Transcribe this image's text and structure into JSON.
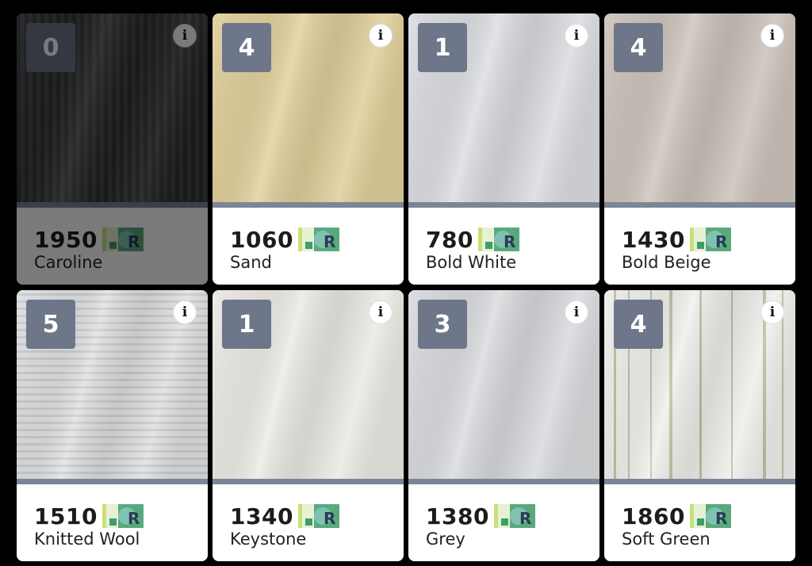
{
  "products": [
    {
      "qty": "0",
      "price": "1950",
      "name": "Caroline",
      "unavailable": true,
      "swatch": {
        "base": "#4e4f52",
        "pattern": "stripes-dark"
      }
    },
    {
      "qty": "4",
      "price": "1060",
      "name": "Sand",
      "unavailable": false,
      "swatch": {
        "base": "#e1cf9c",
        "pattern": "plain"
      }
    },
    {
      "qty": "1",
      "price": "780",
      "name": "Bold White",
      "unavailable": false,
      "swatch": {
        "base": "#dcdde1",
        "pattern": "plain"
      }
    },
    {
      "qty": "4",
      "price": "1430",
      "name": "Bold Beige",
      "unavailable": false,
      "swatch": {
        "base": "#cdc3bc",
        "pattern": "plain"
      }
    },
    {
      "qty": "5",
      "price": "1510",
      "name": "Knitted Wool",
      "unavailable": false,
      "swatch": {
        "base": "#dfe0e2",
        "pattern": "horizontal-ribs"
      }
    },
    {
      "qty": "1",
      "price": "1340",
      "name": "Keystone",
      "unavailable": false,
      "swatch": {
        "base": "#eceae4",
        "pattern": "plain"
      }
    },
    {
      "qty": "3",
      "price": "1380",
      "name": "Grey",
      "unavailable": false,
      "swatch": {
        "base": "#dadbde",
        "pattern": "plain"
      }
    },
    {
      "qty": "4",
      "price": "1860",
      "name": "Soft Green",
      "unavailable": false,
      "swatch": {
        "base": "#efefeb",
        "pattern": "green-stripes"
      }
    }
  ],
  "info_icon_glyph": "i",
  "colors": {
    "background": "#000000",
    "badge": "#6e7689",
    "band": "#7c8597",
    "logo_green": "#3f9c6d",
    "logo_lime": "#c7e07a"
  }
}
